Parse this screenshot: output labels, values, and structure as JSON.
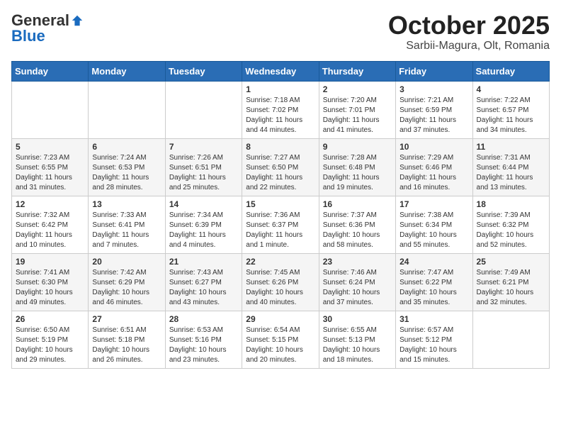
{
  "logo": {
    "general": "General",
    "blue": "Blue"
  },
  "title": "October 2025",
  "location": "Sarbii-Magura, Olt, Romania",
  "days_of_week": [
    "Sunday",
    "Monday",
    "Tuesday",
    "Wednesday",
    "Thursday",
    "Friday",
    "Saturday"
  ],
  "weeks": [
    [
      {
        "day": "",
        "info": ""
      },
      {
        "day": "",
        "info": ""
      },
      {
        "day": "",
        "info": ""
      },
      {
        "day": "1",
        "sunrise": "7:18 AM",
        "sunset": "7:02 PM",
        "daylight": "11 hours and 44 minutes."
      },
      {
        "day": "2",
        "sunrise": "7:20 AM",
        "sunset": "7:01 PM",
        "daylight": "11 hours and 41 minutes."
      },
      {
        "day": "3",
        "sunrise": "7:21 AM",
        "sunset": "6:59 PM",
        "daylight": "11 hours and 37 minutes."
      },
      {
        "day": "4",
        "sunrise": "7:22 AM",
        "sunset": "6:57 PM",
        "daylight": "11 hours and 34 minutes."
      }
    ],
    [
      {
        "day": "5",
        "sunrise": "7:23 AM",
        "sunset": "6:55 PM",
        "daylight": "11 hours and 31 minutes."
      },
      {
        "day": "6",
        "sunrise": "7:24 AM",
        "sunset": "6:53 PM",
        "daylight": "11 hours and 28 minutes."
      },
      {
        "day": "7",
        "sunrise": "7:26 AM",
        "sunset": "6:51 PM",
        "daylight": "11 hours and 25 minutes."
      },
      {
        "day": "8",
        "sunrise": "7:27 AM",
        "sunset": "6:50 PM",
        "daylight": "11 hours and 22 minutes."
      },
      {
        "day": "9",
        "sunrise": "7:28 AM",
        "sunset": "6:48 PM",
        "daylight": "11 hours and 19 minutes."
      },
      {
        "day": "10",
        "sunrise": "7:29 AM",
        "sunset": "6:46 PM",
        "daylight": "11 hours and 16 minutes."
      },
      {
        "day": "11",
        "sunrise": "7:31 AM",
        "sunset": "6:44 PM",
        "daylight": "11 hours and 13 minutes."
      }
    ],
    [
      {
        "day": "12",
        "sunrise": "7:32 AM",
        "sunset": "6:42 PM",
        "daylight": "11 hours and 10 minutes."
      },
      {
        "day": "13",
        "sunrise": "7:33 AM",
        "sunset": "6:41 PM",
        "daylight": "11 hours and 7 minutes."
      },
      {
        "day": "14",
        "sunrise": "7:34 AM",
        "sunset": "6:39 PM",
        "daylight": "11 hours and 4 minutes."
      },
      {
        "day": "15",
        "sunrise": "7:36 AM",
        "sunset": "6:37 PM",
        "daylight": "11 hours and 1 minute."
      },
      {
        "day": "16",
        "sunrise": "7:37 AM",
        "sunset": "6:36 PM",
        "daylight": "10 hours and 58 minutes."
      },
      {
        "day": "17",
        "sunrise": "7:38 AM",
        "sunset": "6:34 PM",
        "daylight": "10 hours and 55 minutes."
      },
      {
        "day": "18",
        "sunrise": "7:39 AM",
        "sunset": "6:32 PM",
        "daylight": "10 hours and 52 minutes."
      }
    ],
    [
      {
        "day": "19",
        "sunrise": "7:41 AM",
        "sunset": "6:30 PM",
        "daylight": "10 hours and 49 minutes."
      },
      {
        "day": "20",
        "sunrise": "7:42 AM",
        "sunset": "6:29 PM",
        "daylight": "10 hours and 46 minutes."
      },
      {
        "day": "21",
        "sunrise": "7:43 AM",
        "sunset": "6:27 PM",
        "daylight": "10 hours and 43 minutes."
      },
      {
        "day": "22",
        "sunrise": "7:45 AM",
        "sunset": "6:26 PM",
        "daylight": "10 hours and 40 minutes."
      },
      {
        "day": "23",
        "sunrise": "7:46 AM",
        "sunset": "6:24 PM",
        "daylight": "10 hours and 37 minutes."
      },
      {
        "day": "24",
        "sunrise": "7:47 AM",
        "sunset": "6:22 PM",
        "daylight": "10 hours and 35 minutes."
      },
      {
        "day": "25",
        "sunrise": "7:49 AM",
        "sunset": "6:21 PM",
        "daylight": "10 hours and 32 minutes."
      }
    ],
    [
      {
        "day": "26",
        "sunrise": "6:50 AM",
        "sunset": "5:19 PM",
        "daylight": "10 hours and 29 minutes."
      },
      {
        "day": "27",
        "sunrise": "6:51 AM",
        "sunset": "5:18 PM",
        "daylight": "10 hours and 26 minutes."
      },
      {
        "day": "28",
        "sunrise": "6:53 AM",
        "sunset": "5:16 PM",
        "daylight": "10 hours and 23 minutes."
      },
      {
        "day": "29",
        "sunrise": "6:54 AM",
        "sunset": "5:15 PM",
        "daylight": "10 hours and 20 minutes."
      },
      {
        "day": "30",
        "sunrise": "6:55 AM",
        "sunset": "5:13 PM",
        "daylight": "10 hours and 18 minutes."
      },
      {
        "day": "31",
        "sunrise": "6:57 AM",
        "sunset": "5:12 PM",
        "daylight": "10 hours and 15 minutes."
      },
      {
        "day": "",
        "info": ""
      }
    ]
  ]
}
